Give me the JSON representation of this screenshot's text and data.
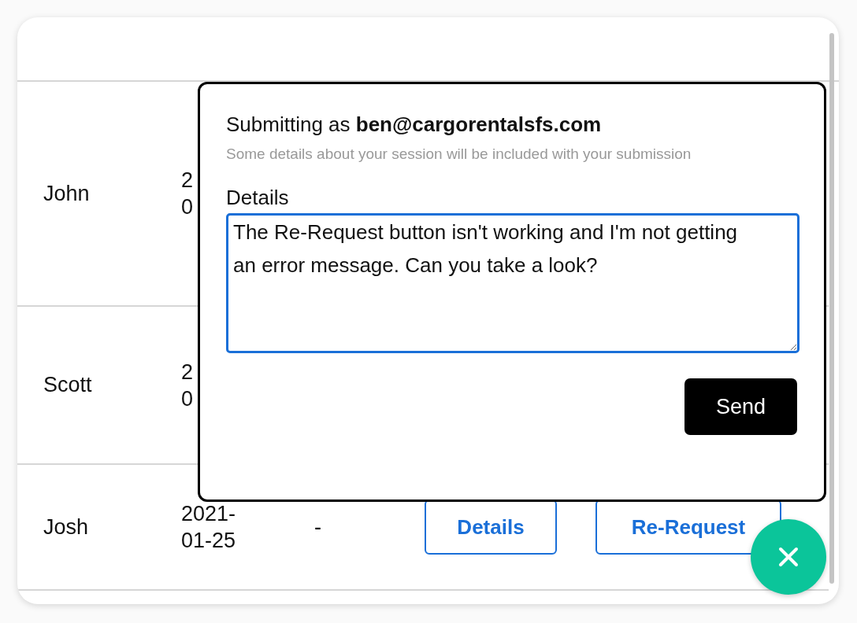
{
  "table": {
    "rows": [
      {
        "name": "John",
        "date_lines": [
          "2",
          "0"
        ]
      },
      {
        "name": "Scott",
        "date_lines": [
          "2",
          "0"
        ]
      },
      {
        "name": "Josh",
        "date_lines": [
          "2021-",
          "01-25"
        ],
        "column_3": "-",
        "actions": [
          "Details",
          "Re-Request"
        ]
      }
    ]
  },
  "feedback_popup": {
    "intro": "Submitting as **ben@cargorentalsfs.com**",
    "hint": "Some details about your session will be included with your submission",
    "details_label": "Details",
    "details_value": "The Re-Request button isn't working and I'm not getting an error message. Can you take a look?",
    "send": "Send"
  },
  "fab": {
    "open": true
  }
}
